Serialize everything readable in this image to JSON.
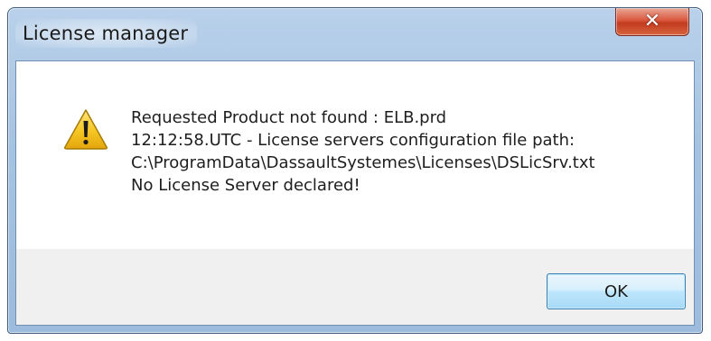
{
  "window": {
    "title": "License manager",
    "close_label": "✕",
    "close_icon": "close-icon"
  },
  "message": {
    "icon": "warning-icon",
    "lines": [
      "Requested Product not found : ELB.prd",
      "12:12:58.UTC - License servers configuration file path:",
      "C:\\ProgramData\\DassaultSystemes\\Licenses\\DSLicSrv.txt",
      "No License Server declared!"
    ]
  },
  "buttons": {
    "ok_label": "OK"
  },
  "colors": {
    "title_bar": "#a7c3e2",
    "close_button": "#c23b1f",
    "warning_yellow": "#f2c21a",
    "ok_button_border": "#3c7fb1"
  }
}
